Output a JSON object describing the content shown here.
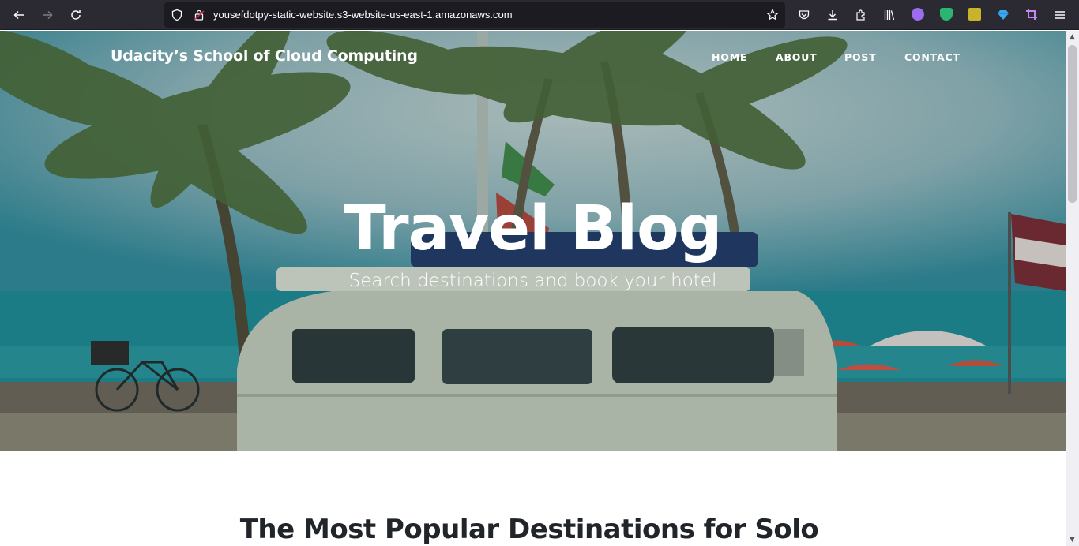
{
  "browser": {
    "url": "yousefdotpy-static-website.s3-website-us-east-1.amazonaws.com",
    "colors": {
      "toolbar": "#2b2a33",
      "urlbar": "#1c1b22"
    },
    "icons": [
      "back-arrow-icon",
      "forward-arrow-icon",
      "reload-icon",
      "shield-icon",
      "lock-icon",
      "bookmark-star-icon",
      "pocket-icon",
      "download-icon",
      "extensions-icon",
      "library-icon",
      "account-icon",
      "shield-extension-icon",
      "extension-icon",
      "gem-extension-icon",
      "crop-extension-icon",
      "menu-icon"
    ]
  },
  "site": {
    "brand": "Udacity’s School of Cloud Computing",
    "nav": [
      {
        "label": "HOME"
      },
      {
        "label": "ABOUT"
      },
      {
        "label": "POST"
      },
      {
        "label": "CONTACT"
      }
    ],
    "hero": {
      "title": "Travel Blog",
      "subtitle": "Search destinations and book your hotel"
    },
    "section_heading": "The Most Popular Destinations for Solo"
  }
}
